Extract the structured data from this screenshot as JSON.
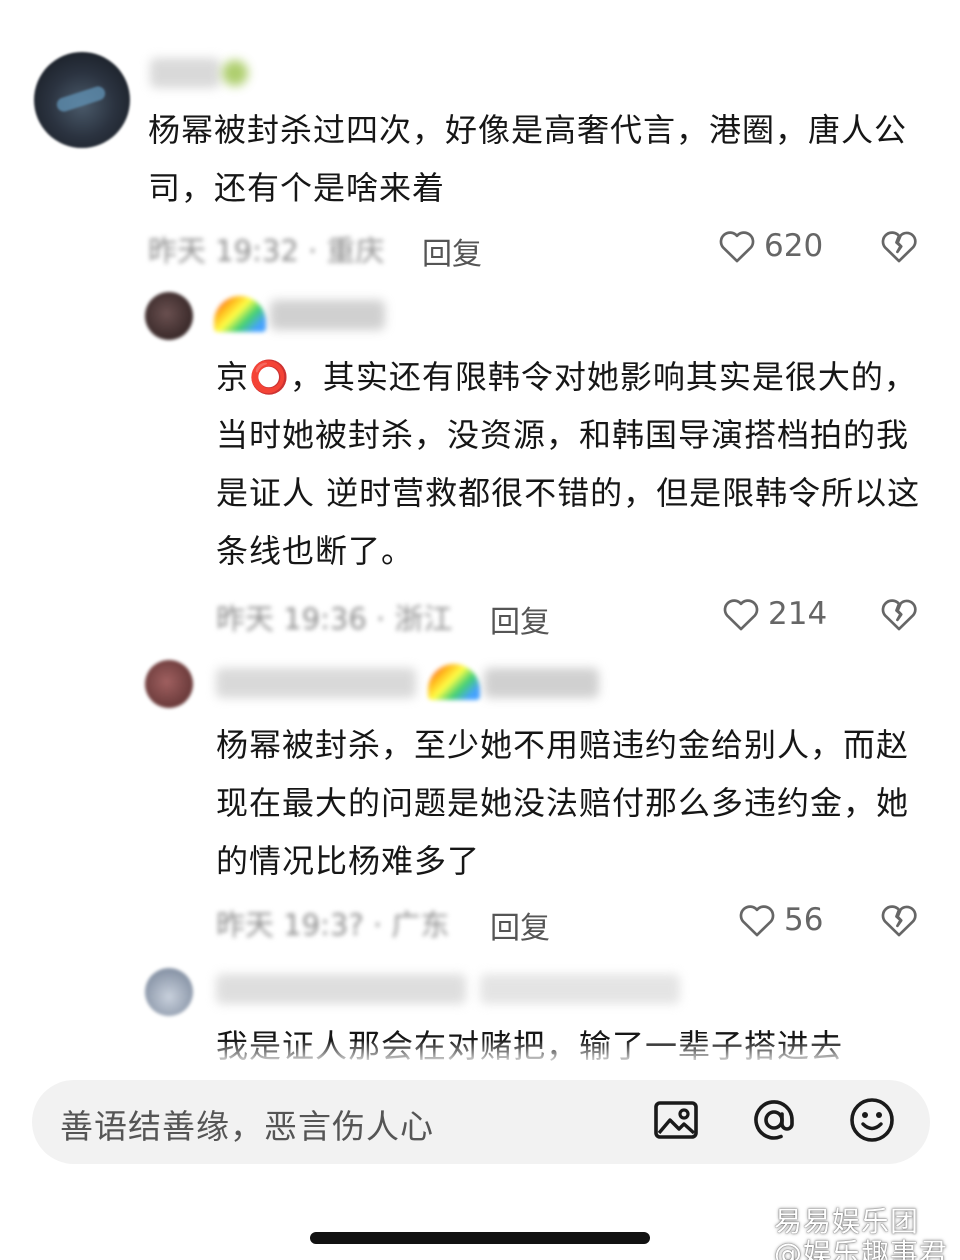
{
  "comments": [
    {
      "text": "杨幂被封杀过四次，好像是高奢代言，港圈，唐人公司，还有个是啥来着",
      "time_location": "昨天 19:32 · 重庆",
      "reply_label": "回复",
      "likes": "620"
    },
    {
      "text": "京⭕，其实还有限韩令对她影响其实是很大的，当时她被封杀，没资源，和韩国导演搭档拍的我是证人  逆时营救都很不错的，但是限韩令所以这条线也断了。",
      "time_location": "昨天 19:36 · 浙江",
      "reply_label": "回复",
      "likes": "214"
    },
    {
      "text": "杨幂被封杀，至少她不用赔违约金给别人，而赵现在最大的问题是她没法赔付那么多违约金，她的情况比杨难多了",
      "time_location": "昨天 19:3? · 广东",
      "reply_label": "回复",
      "likes": "56"
    },
    {
      "text": "我是证人那会在对赌把，输了一辈子搭进去"
    }
  ],
  "composer": {
    "placeholder": "善语结善缘，恶言伤人心"
  },
  "icons": {
    "like": "heart-outline-icon",
    "dislike": "broken-heart-icon",
    "image": "image-icon",
    "mention": "at-sign-icon",
    "emoji": "smiley-icon"
  },
  "watermark": "易易娱乐团\n@娱乐趣事君"
}
